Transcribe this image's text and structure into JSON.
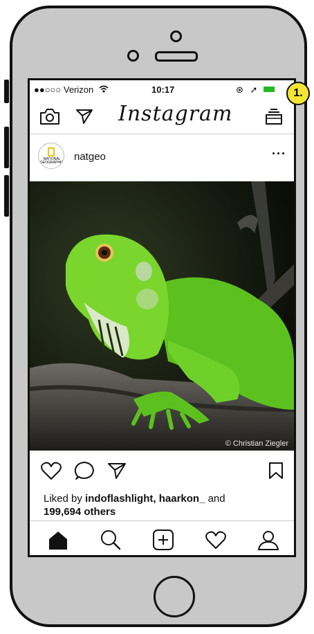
{
  "status_bar": {
    "carrier": "●●○○○ Verizon",
    "time": "10:17",
    "icons": "⊛ ➚"
  },
  "callout_label": "1.",
  "header": {
    "logo": "Instagram",
    "left_icons": [
      "camera-icon",
      "send-icon"
    ],
    "right_icon": "inbox-icon"
  },
  "post": {
    "username": "natgeo",
    "avatar_text": "NATIONAL GEOGRAPHIC",
    "more": "···",
    "photo_credit": "© Christian Ziegler",
    "likes_prefix": "Liked by ",
    "liker1": "indoflashlight",
    "separator": ", ",
    "liker2": "haarkon_",
    "likes_mid": " and",
    "likes_count": "199,694 others"
  },
  "tabbar": {
    "items": [
      "home-icon",
      "search-icon",
      "add-icon",
      "heart-icon",
      "profile-icon"
    ]
  },
  "colors": {
    "battery": "#22bb22",
    "callout": "#f3e534",
    "iguana": "#5cc11f"
  }
}
